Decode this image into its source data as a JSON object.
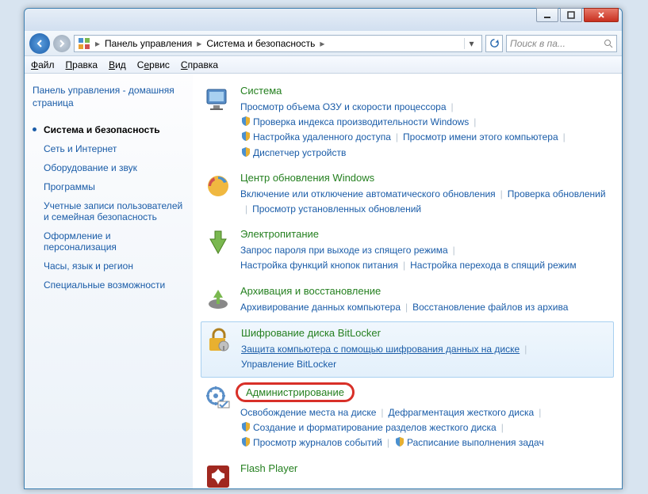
{
  "breadcrumb": {
    "item1": "Панель управления",
    "item2": "Система и безопасность"
  },
  "search_placeholder": "Поиск в па...",
  "menu": {
    "file": "Файл",
    "edit": "Правка",
    "view": "Вид",
    "tools": "Сервис",
    "help": "Справка"
  },
  "sidebar": {
    "home": "Панель управления - домашняя страница",
    "items": [
      "Система и безопасность",
      "Сеть и Интернет",
      "Оборудование и звук",
      "Программы",
      "Учетные записи пользователей и семейная безопасность",
      "Оформление и персонализация",
      "Часы, язык и регион",
      "Специальные возможности"
    ]
  },
  "categories": [
    {
      "title": "Система",
      "links": [
        {
          "t": "Просмотр объема ОЗУ и скорости процессора",
          "s": false
        },
        {
          "t": "Проверка индекса производительности Windows",
          "s": true
        },
        {
          "t": "Настройка удаленного доступа",
          "s": true
        },
        {
          "t": "Просмотр имени этого компьютера",
          "s": false
        },
        {
          "t": "Диспетчер устройств",
          "s": true
        }
      ]
    },
    {
      "title": "Центр обновления Windows",
      "links": [
        {
          "t": "Включение или отключение автоматического обновления",
          "s": false
        },
        {
          "t": "Проверка обновлений",
          "s": false
        },
        {
          "t": "Просмотр установленных обновлений",
          "s": false
        }
      ]
    },
    {
      "title": "Электропитание",
      "links": [
        {
          "t": "Запрос пароля при выходе из спящего режима",
          "s": false
        },
        {
          "t": "Настройка функций кнопок питания",
          "s": false
        },
        {
          "t": "Настройка перехода в спящий режим",
          "s": false
        }
      ]
    },
    {
      "title": "Архивация и восстановление",
      "links": [
        {
          "t": "Архивирование данных компьютера",
          "s": false
        },
        {
          "t": "Восстановление файлов из архива",
          "s": false
        }
      ]
    },
    {
      "title": "Шифрование диска BitLocker",
      "links": [
        {
          "t": "Защита компьютера с помощью шифрования данных на диске",
          "s": false,
          "u": true
        },
        {
          "t": "Управление BitLocker",
          "s": false
        }
      ]
    },
    {
      "title": "Администрирование",
      "links": [
        {
          "t": "Освобождение места на диске",
          "s": false
        },
        {
          "t": "Дефрагментация жесткого диска",
          "s": false
        },
        {
          "t": "Создание и форматирование разделов жесткого диска",
          "s": true
        },
        {
          "t": "Просмотр журналов событий",
          "s": true
        },
        {
          "t": "Расписание выполнения задач",
          "s": true
        }
      ]
    },
    {
      "title": "Flash Player",
      "links": []
    }
  ]
}
